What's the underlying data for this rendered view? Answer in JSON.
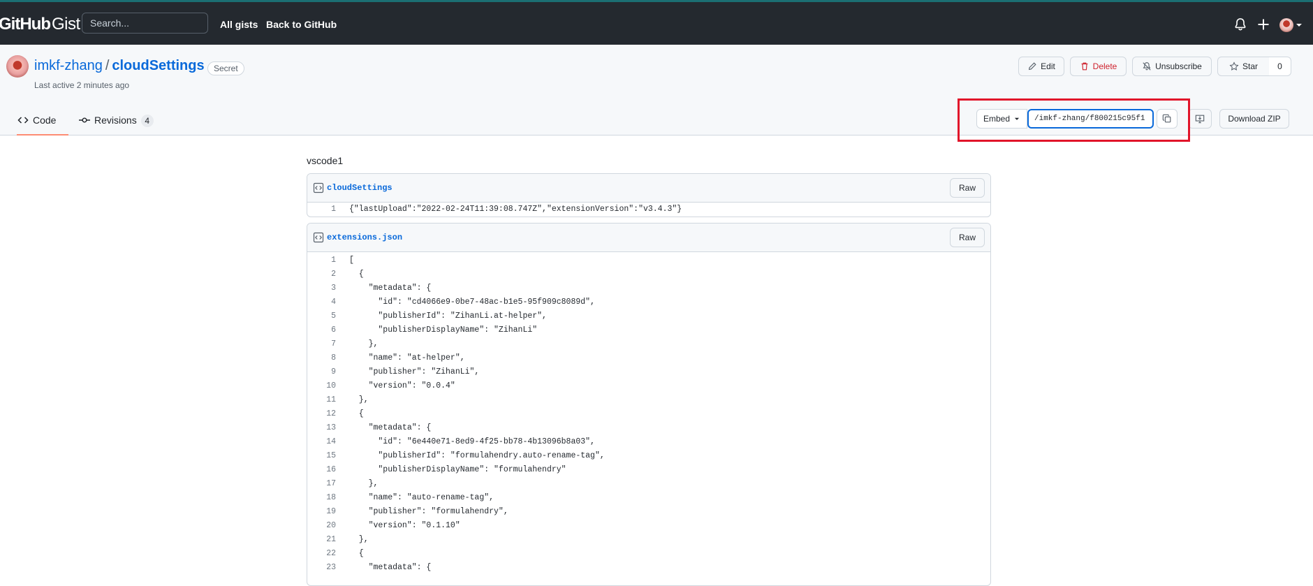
{
  "topbar": {
    "logo_bold": "GitHub",
    "logo_light": "Gist",
    "search_placeholder": "Search...",
    "links": [
      "All gists",
      "Back to GitHub"
    ],
    "icons": [
      "bell-icon",
      "plus-icon",
      "avatar",
      "chevron-down-icon"
    ]
  },
  "gist": {
    "owner": "imkf-zhang",
    "separator": "/",
    "name": "cloudSettings",
    "badge": "Secret",
    "last_active": "Last active 2 minutes ago",
    "actions": {
      "edit": "Edit",
      "delete": "Delete",
      "unsubscribe": "Unsubscribe",
      "star": "Star",
      "star_count": "0"
    },
    "tabs": [
      {
        "label": "Code",
        "active": true
      },
      {
        "label": "Revisions",
        "count": "4"
      }
    ],
    "embed": {
      "label": "Embed",
      "value": "/imkf-zhang/f800215c95f1",
      "download": "Download ZIP"
    }
  },
  "content": {
    "description": "vscode1",
    "files": [
      {
        "name": "cloudSettings",
        "raw": "Raw",
        "lines": [
          "{\"lastUpload\":\"2022-02-24T11:39:08.747Z\",\"extensionVersion\":\"v3.4.3\"}"
        ]
      },
      {
        "name": "extensions.json",
        "raw": "Raw",
        "lines": [
          "[",
          "  {",
          "    \"metadata\": {",
          "      \"id\": \"cd4066e9-0be7-48ac-b1e5-95f909c8089d\",",
          "      \"publisherId\": \"ZihanLi.at-helper\",",
          "      \"publisherDisplayName\": \"ZihanLi\"",
          "    },",
          "    \"name\": \"at-helper\",",
          "    \"publisher\": \"ZihanLi\",",
          "    \"version\": \"0.0.4\"",
          "  },",
          "  {",
          "    \"metadata\": {",
          "      \"id\": \"6e440e71-8ed9-4f25-bb78-4b13096b8a03\",",
          "      \"publisherId\": \"formulahendry.auto-rename-tag\",",
          "      \"publisherDisplayName\": \"formulahendry\"",
          "    },",
          "    \"name\": \"auto-rename-tag\",",
          "    \"publisher\": \"formulahendry\",",
          "    \"version\": \"0.1.10\"",
          "  },",
          "  {",
          "    \"metadata\": {"
        ]
      }
    ]
  }
}
